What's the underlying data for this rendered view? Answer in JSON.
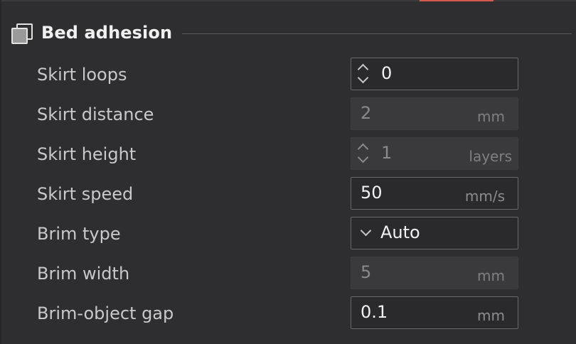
{
  "section": {
    "title": "Bed adhesion",
    "icon": "layers-icon"
  },
  "rows": [
    {
      "label": "Skirt loops",
      "value": "0",
      "unit": "",
      "control": "spinner",
      "enabled": true
    },
    {
      "label": "Skirt distance",
      "value": "2",
      "unit": "mm",
      "control": "text",
      "enabled": false
    },
    {
      "label": "Skirt height",
      "value": "1",
      "unit": "layers",
      "control": "spinner",
      "enabled": false
    },
    {
      "label": "Skirt speed",
      "value": "50",
      "unit": "mm/s",
      "control": "text",
      "enabled": true
    },
    {
      "label": "Brim type",
      "value": "Auto",
      "unit": "",
      "control": "dropdown",
      "enabled": true
    },
    {
      "label": "Brim width",
      "value": "5",
      "unit": "mm",
      "control": "text",
      "enabled": false
    },
    {
      "label": "Brim-object gap",
      "value": "0.1",
      "unit": "mm",
      "control": "text",
      "enabled": true
    }
  ],
  "colors": {
    "background": "#2e2e31",
    "accent": "#d35a4c",
    "field_border": "#6a6a6e",
    "disabled_field": "#3a3a3d"
  }
}
